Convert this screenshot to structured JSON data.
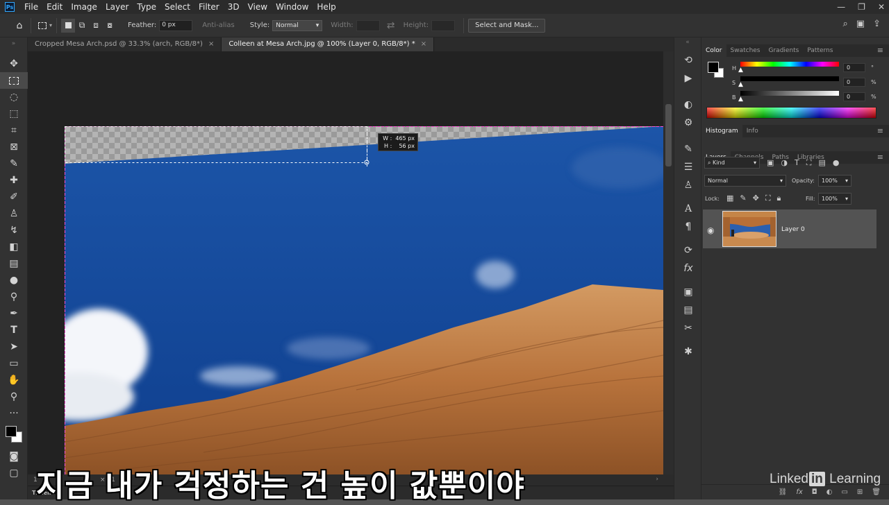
{
  "menubar": {
    "app_icon": "Ps",
    "items": [
      "File",
      "Edit",
      "Image",
      "Layer",
      "Type",
      "Select",
      "Filter",
      "3D",
      "View",
      "Window",
      "Help"
    ]
  },
  "options": {
    "feather_label": "Feather:",
    "feather_value": "0 px",
    "antialias_label": "Anti-alias",
    "style_label": "Style:",
    "style_value": "Normal",
    "width_label": "Width:",
    "height_label": "Height:",
    "select_mask_label": "Select and Mask..."
  },
  "tabs": [
    {
      "label": "Cropped Mesa Arch.psd @ 33.3% (arch, RGB/8*)",
      "close": "×"
    },
    {
      "label": "Colleen at Mesa Arch.jpg @ 100% (Layer 0, RGB/8*) *",
      "close": "×"
    }
  ],
  "tooltip": {
    "text": "W :  465 px\nH :    56 px"
  },
  "status": {
    "zoom": "1",
    "dims": "× 31"
  },
  "timeline_label": "Timeline",
  "color_panel": {
    "tabs": [
      "Color",
      "Swatches",
      "Gradients",
      "Patterns"
    ],
    "h_label": "H",
    "h_value": "0",
    "h_unit": "°",
    "s_label": "S",
    "s_value": "0",
    "s_unit": "%",
    "b_label": "B",
    "b_value": "0",
    "b_unit": "%"
  },
  "histogram_panel": {
    "tabs": [
      "Histogram",
      "Info"
    ]
  },
  "layers_panel": {
    "tabs": [
      "Layers",
      "Channels",
      "Paths",
      "Libraries"
    ],
    "kind_label": "Kind",
    "blend_mode": "Normal",
    "opacity_label": "Opacity:",
    "opacity_value": "100%",
    "lock_label": "Lock:",
    "fill_label": "Fill:",
    "fill_value": "100%",
    "layers": [
      {
        "name": "Layer 0",
        "visible": true
      }
    ]
  },
  "subtitle": "지금 내가 걱정하는 건 높이 값뿐이야",
  "watermark": {
    "pre": "Linked",
    "in": "in",
    "post": " Learning"
  },
  "colors": {
    "accent": "#31a8ff",
    "sky": "#1650a0",
    "rock": "#c2824a",
    "selection": "#ff4fd8"
  }
}
